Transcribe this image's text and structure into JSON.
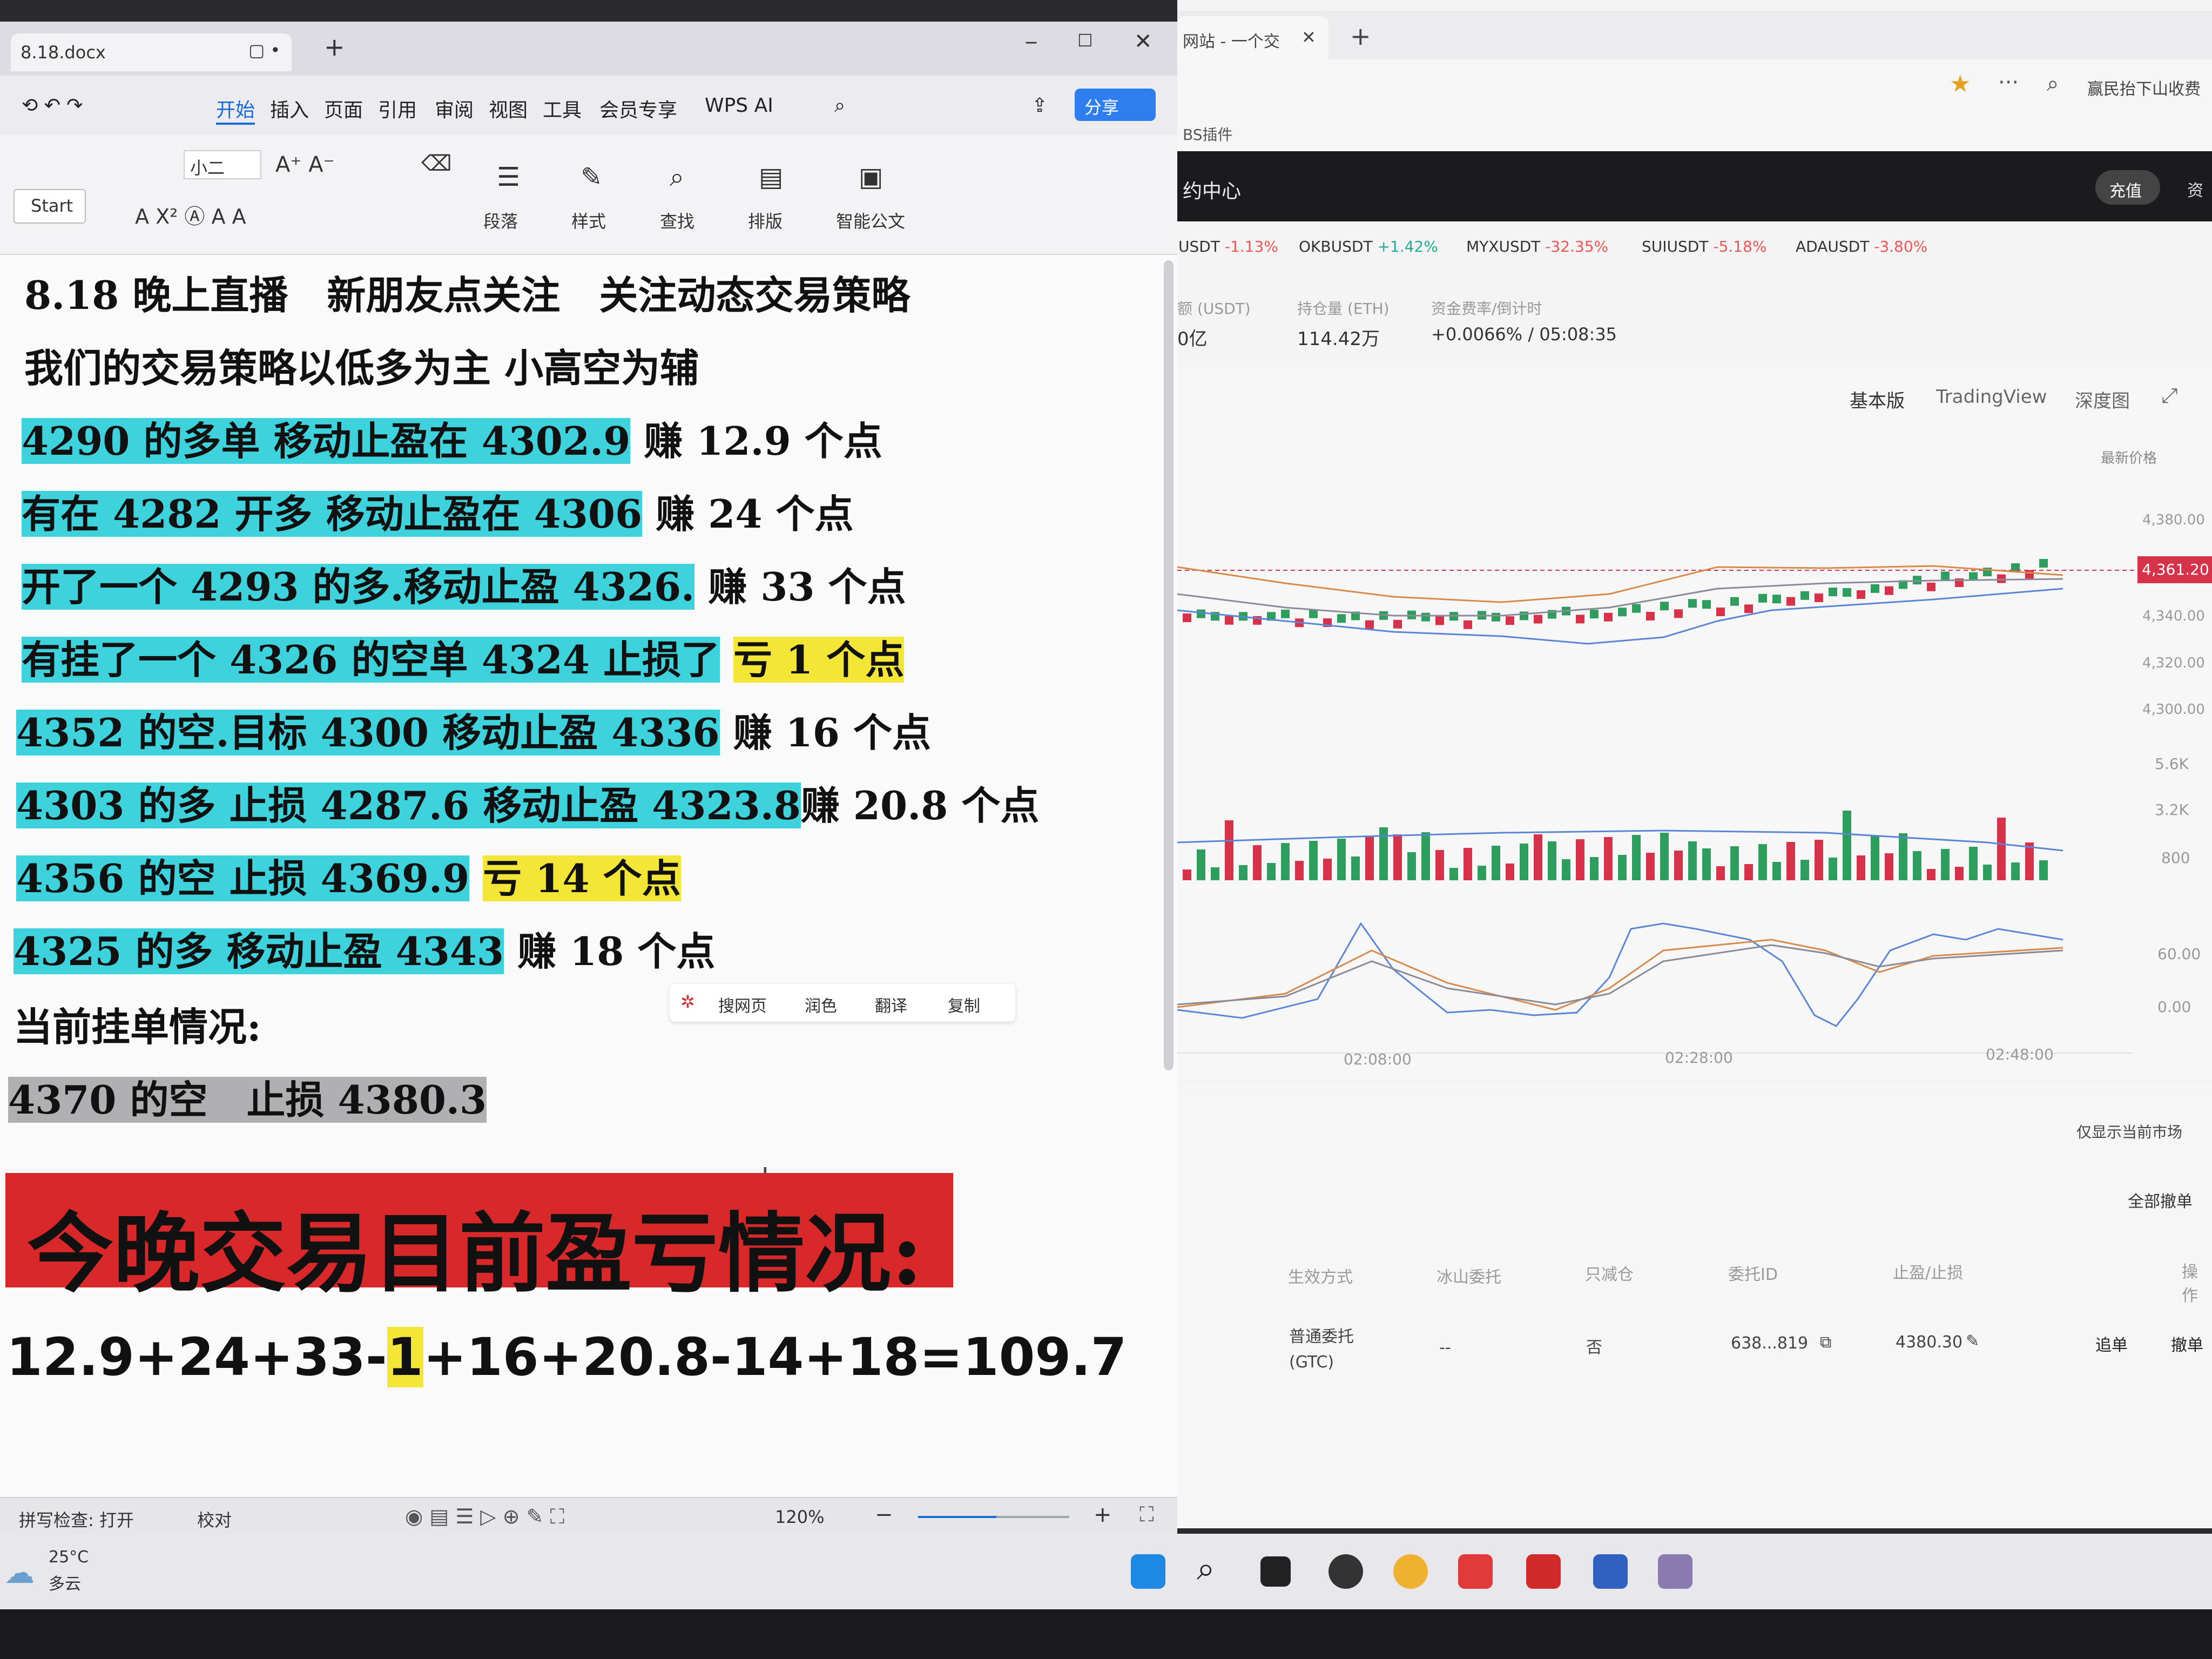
{
  "wps": {
    "doc_title": "8.18.docx",
    "menu": [
      "开始",
      "插入",
      "页面",
      "引用",
      "审阅",
      "视图",
      "工具",
      "会员专享",
      "WPS AI"
    ],
    "share_label": "分享",
    "ribbon": {
      "start_btn": "Start",
      "font_size": "小二",
      "labels": [
        "段落",
        "样式",
        "查找",
        "排版",
        "智能公文"
      ]
    },
    "doc": {
      "line1": "8.18 晚上直播　新朋友点关注　关注动态交易策略",
      "line2": "我们的交易策略以低多为主 小高空为辅",
      "trades": [
        {
          "a": "4290 的多单",
          "b": "移动止盈在 4302.9",
          "r": "赚 12.9 个点"
        },
        {
          "a": "有在 4282 开多",
          "b": "移动止盈在 4306",
          "r": "赚 24 个点"
        },
        {
          "a": "开了一个 4293 的多.",
          "b": "移动止盈 4326.",
          "r": "赚 33 个点"
        },
        {
          "a": "有挂了一个 4326 的空单 4324 止损了",
          "r": "亏 1 个点"
        },
        {
          "a": "4352 的空.目标 4300",
          "b": "移动止盈 4336",
          "r": "赚 16 个点"
        },
        {
          "a": "4303 的多",
          "b": "止损 4287.6 移动止盈 4323.8",
          "r": "赚 20.8 个点"
        },
        {
          "a": "4356 的空 止损 4369.9",
          "r": "亏 14 个点"
        },
        {
          "a": "4325 的多",
          "b": "移动止盈 4343",
          "r": "赚 18 个点"
        }
      ],
      "pending_title": "当前挂单情况:",
      "pending_line": "4370 的空　止损 4380.3",
      "banner": "今晚交易目前盈亏情况:",
      "sum_prefix": "12.9+24+33-",
      "sum_highlight": "1",
      "sum_suffix": "+16+20.8-14+18=109.7"
    },
    "context_toolbar": [
      "搜网页",
      "润色",
      "翻译",
      "复制"
    ],
    "status": {
      "spell": "拼写检查: 打开",
      "proof": "校对",
      "zoom": "120%"
    }
  },
  "exchange": {
    "tab_title": "网站 - 一个交",
    "bookmark": "BS插件",
    "address_right": "赢民抬下山收费",
    "nav_title": "约中心",
    "recharge": "充值",
    "nav_more": "资",
    "tickers": [
      {
        "sym": "USDT",
        "chg": "-1.13%"
      },
      {
        "sym": "OKBUSDT",
        "chg": "+1.42%"
      },
      {
        "sym": "MYXUSDT",
        "chg": "-32.35%"
      },
      {
        "sym": "SUIUSDT",
        "chg": "-5.18%"
      },
      {
        "sym": "ADAUSDT",
        "chg": "-3.80%"
      }
    ],
    "stats": [
      {
        "label": "额 (USDT)",
        "value": "0亿"
      },
      {
        "label": "持仓量 (ETH)",
        "value": "114.42万"
      },
      {
        "label": "资金费率/倒计时",
        "value": "+0.0066% / 05:08:35"
      }
    ],
    "chart_tabs": [
      "基本版",
      "TradingView",
      "深度图"
    ],
    "latest_price_label": "最新价格",
    "price_axis": [
      "4,380.00",
      "4,340.00",
      "4,320.00",
      "4,300.00"
    ],
    "current_price": "4,361.20",
    "volume_axis": [
      "5.6K",
      "3.2K",
      "800"
    ],
    "osc_axis": [
      "60.00",
      "0.00"
    ],
    "time_axis": [
      "02:08:00",
      "02:28:00",
      "02:48:00"
    ],
    "only_current": "仅显示当前市场",
    "cancel_all": "全部撤单",
    "order_headers": [
      "生效方式",
      "冰山委托",
      "只减仓",
      "委托ID",
      "止盈/止损",
      "操作"
    ],
    "order_row": {
      "type": "普通委托",
      "gtc": "(GTC)",
      "iceberg": "--",
      "reduce": "否",
      "id": "638...819",
      "tpsl": "4380.30",
      "act1": "追单",
      "act2": "撤单"
    }
  },
  "taskbar": {
    "temp": "25°C",
    "weather": "多云"
  },
  "colors": {
    "cyan_highlight": "#3ed2dc",
    "yellow_highlight": "#f3e636",
    "banner_red": "#d8282a",
    "candle_up": "#2e9e5e",
    "candle_down": "#d6334a",
    "price_tag": "#d6334a"
  }
}
